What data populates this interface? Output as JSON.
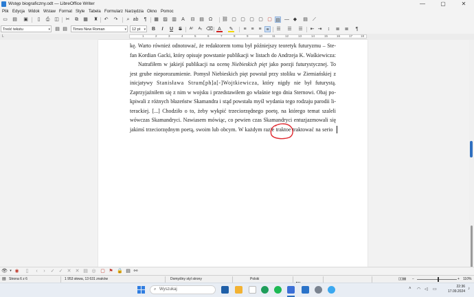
{
  "window": {
    "title": "Wstęp biograficzny.odt — LibreOffice Writer",
    "minimize_glyph": "—",
    "maximize_glyph": "▢",
    "close_glyph": "✕"
  },
  "menu": [
    "Plik",
    "Edycja",
    "Widok",
    "Wstaw",
    "Format",
    "Style",
    "Tabela",
    "Formularz",
    "Narzędzia",
    "Okno",
    "Pomoc"
  ],
  "toolbar": {
    "paragraph_style": "Treść tekstu",
    "font_name": "Times New Roman",
    "font_size": "12 pt",
    "bold": "B",
    "italic": "I",
    "underline": "U",
    "strikethrough": "S"
  },
  "ruler": {
    "numbers": [
      "1",
      "2",
      "3",
      "4",
      "5",
      "6",
      "7",
      "8",
      "9",
      "10",
      "11",
      "12",
      "13",
      "14",
      "15",
      "16",
      "17",
      "18"
    ]
  },
  "document": {
    "lines": [
      "kę. Warto również odnotować, że redaktorem tomu był późniejszy teoretyk futuryzmu – Ste-",
      "fan Kordian Gacki, który opisuje powstanie publikacji w listach do Andrzeja K. Waśkiewicza:",
      "Natrafiłem w jakiejś publikacji na ocenę ",
      "Niebieskich pięt",
      " jako poezji futurystycznej. To",
      "jest grube nieporozumienie. Pomysł Niebieskich pięt powstał przy stoliku w Ziemiańskiej z",
      "inicjatywy ",
      "Stanisława Strum[ph]a[-]Wojtkiewicza",
      ", który nigdy nie był futurystą.",
      "Zaprzyjaźniłem się z nim w wojsku i przedstawiłem go właśnie tego dnia Sternowi. Obaj po-",
      "kpiwali z różnych błazeństw Skamandra i stąd powstała myśl wydania tego rodzaju parodii li-",
      "terackiej. [...] Chodziło o to, żeby wykpić trzeciorzędnego poetę, na którego temat szaleli",
      "wówczas Skamandryci. Nawiasem mówiąc, co pewien czas Skamandryci entuzjazmowali się",
      "jakimś trzeciorzędnym poetą, swoim lub obcym. W każdym razie traktoe  traktować  na  serio"
    ]
  },
  "status": {
    "page": "Strona 6 z 6",
    "words": "1 953 słowa, 13 631 znaków",
    "page_style": "Domyślny styl strony",
    "language": "Polski",
    "zoom": "110%"
  },
  "taskbar": {
    "search_placeholder": "Wyszukaj",
    "time": "22:36",
    "date": "17.09.2024"
  },
  "colors": {
    "accent": "#2f6fbf",
    "annotation": "#e0282f"
  }
}
